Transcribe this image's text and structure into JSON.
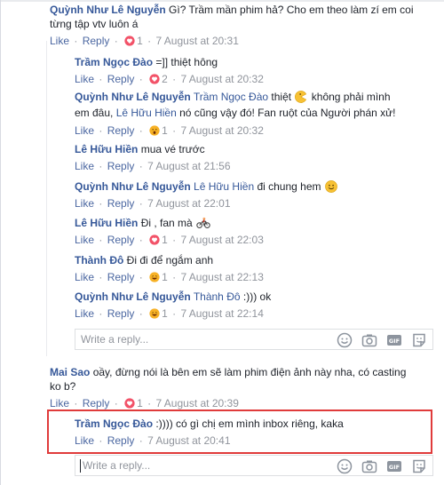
{
  "actions": {
    "like": "Like",
    "reply": "Reply",
    "sep": "·"
  },
  "comments": [
    {
      "name": "Quỳnh Như Lê Nguyễn",
      "text1": " Gì? Trầm mần phim hả? Cho em theo làm zí em coi",
      "text2": "từng tập vtv luôn á",
      "reactions": "1",
      "time": "7 August at 20:31"
    },
    {
      "name": "Trầm Ngọc Đào",
      "text": " =]] thiệt hông",
      "reactions": "2",
      "time": "7 August at 20:32"
    },
    {
      "name": "Quỳnh Như Lê Nguyễn",
      "tag": "Trầm Ngọc Đào",
      "text1": " thiệt ",
      "text1b": " không phải mình",
      "text2a": "em đâu, ",
      "tag2": "Lê Hữu Hiền",
      "text2b": " nó cũng vậy đó! Fan ruột của Người phán xử!",
      "reactions": "1",
      "time": "7 August at 20:32"
    },
    {
      "name": "Lê Hữu Hiền",
      "text": " mua vé trước",
      "time": "7 August at 21:56"
    },
    {
      "name": "Quỳnh Như Lê Nguyễn",
      "tag": "Lê Hữu Hiền",
      "text": " đi chung hem ",
      "time": "7 August at 22:01"
    },
    {
      "name": "Lê Hữu Hiền",
      "text": " Đi , fan mà ",
      "reactions": "1",
      "time": "7 August at 22:03"
    },
    {
      "name": "Thành Đô",
      "text": " Đi đi để ngắm anh",
      "reactions": "1",
      "time": "7 August at 22:13"
    },
    {
      "name": "Quỳnh Như Lê Nguyễn",
      "tag": "Thành Đô",
      "text": " :))) ok",
      "reactions": "1",
      "time": "7 August at 22:14"
    },
    {
      "name": "Mai Sao",
      "text1": " oầy, đừng nói là bên em sẽ làm phim điện ảnh này nha, có casting",
      "text2": "ko b?",
      "reactions": "1",
      "time": "7 August at 20:39"
    },
    {
      "name": "Trầm Ngọc Đào",
      "text": " :)))) có gì chị em mình inbox riêng, kaka",
      "time": "7 August at 20:41"
    }
  ],
  "reply_box": {
    "placeholder": "Write a reply..."
  },
  "icons": [
    "smiley-icon",
    "camera-icon",
    "gif-icon",
    "sticker-icon"
  ],
  "colors": {
    "name": "#365899",
    "link": "#4b67a1",
    "meta": "#90949c",
    "highlight": "#e03b3b",
    "love": "#f25268",
    "haha": "#f7b125"
  }
}
